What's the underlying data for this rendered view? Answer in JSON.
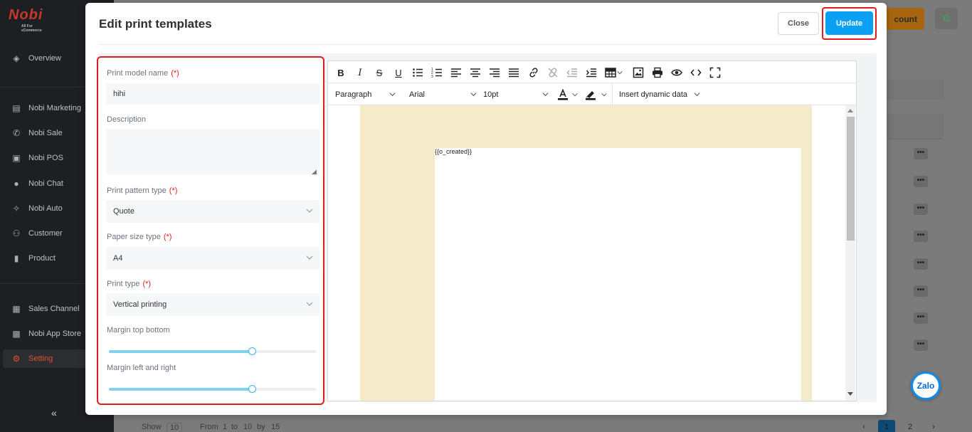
{
  "sidebar": {
    "logo_text": "Nobi",
    "logo_sub": "All For eCommerce",
    "items": [
      {
        "label": "Overview",
        "icon": "layers-icon"
      },
      {
        "label": "Nobi Marketing",
        "icon": "store-icon"
      },
      {
        "label": "Nobi Sale",
        "icon": "phone-icon"
      },
      {
        "label": "Nobi POS",
        "icon": "cash-icon"
      },
      {
        "label": "Nobi Chat",
        "icon": "chat-icon"
      },
      {
        "label": "Nobi Auto",
        "icon": "auto-icon"
      },
      {
        "label": "Customer",
        "icon": "users-icon"
      },
      {
        "label": "Product",
        "icon": "file-icon"
      },
      {
        "label": "Sales Channel",
        "icon": "shop-icon"
      },
      {
        "label": "Nobi App Store",
        "icon": "grid-icon"
      },
      {
        "label": "Setting",
        "icon": "gear-icon",
        "active": true
      }
    ],
    "collapse_glyph": "«"
  },
  "header": {
    "account_btn_label": "count",
    "avatar_initial": "G"
  },
  "background_table": {
    "row_action_glyph": "•••",
    "pager": {
      "show_label": "Show",
      "page_size": "10",
      "from_label": "From",
      "from": "1",
      "to_label": "to",
      "to": "10",
      "by_label": "by",
      "total": "15",
      "pages": [
        "1",
        "2"
      ],
      "current_page": "1"
    }
  },
  "modal": {
    "title": "Edit print templates",
    "close_label": "Close",
    "update_label": "Update"
  },
  "form": {
    "required_mark": "(*)",
    "print_model_name": {
      "label": "Print model name",
      "value": "hihi"
    },
    "description": {
      "label": "Description",
      "value": ""
    },
    "print_pattern_type": {
      "label": "Print pattern type",
      "value": "Quote"
    },
    "paper_size_type": {
      "label": "Paper size type",
      "value": "A4"
    },
    "print_type": {
      "label": "Print type",
      "value": "Vertical printing"
    },
    "margin_top_bottom": {
      "label": "Margin top bottom",
      "value_fraction": 0.69
    },
    "margin_left_right": {
      "label": "Margin left and right",
      "value_fraction": 0.69
    }
  },
  "editor": {
    "block_format": "Paragraph",
    "font_family": "Arial",
    "font_size": "10pt",
    "insert_dynamic_label": "Insert dynamic data",
    "content": "{{o_created}}",
    "toolbar_icons": [
      "bold-icon",
      "italic-icon",
      "strikethrough-icon",
      "underline-icon",
      "bullet-list-icon",
      "numbered-list-icon",
      "align-left-icon",
      "align-center-icon",
      "align-right-icon",
      "justify-icon",
      "link-icon",
      "unlink-icon",
      "outdent-icon",
      "indent-icon",
      "table-icon",
      "image-icon",
      "print-icon",
      "preview-icon",
      "code-icon",
      "fullscreen-icon"
    ]
  },
  "zalo_label": "Zalo",
  "colors": {
    "primary": "#0aa1f4",
    "highlight": "#e11d1d",
    "sidebar_bg": "#1e1f22",
    "active_nav": "#e4512f",
    "page_bg": "#f5ebca"
  }
}
